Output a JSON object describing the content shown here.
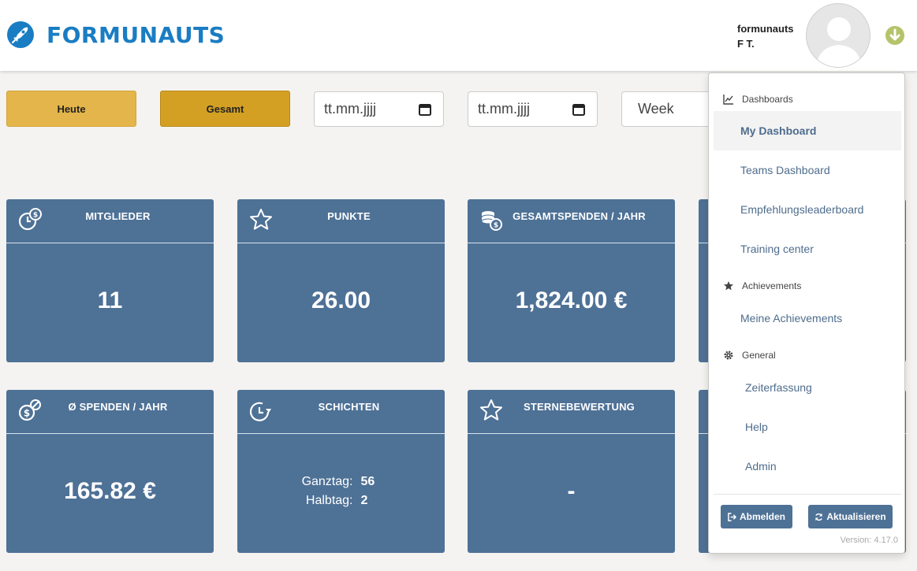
{
  "header": {
    "logo_text": "FORMUNAUTS",
    "user_name": "formunauts",
    "user_initials": "F T."
  },
  "filters": {
    "heute_label": "Heute",
    "gesamt_label": "Gesamt",
    "date_from_placeholder": "tt.mm.jjjj",
    "date_to_placeholder": "tt.mm.jjjj",
    "period_value": "Week"
  },
  "cards": {
    "mitglieder": {
      "title": "MITGLIEDER",
      "value": "11",
      "icon": "clock-dollar-icon"
    },
    "punkte": {
      "title": "PUNKTE",
      "value": "26.00",
      "icon": "star-icon"
    },
    "gesamtspenden": {
      "title": "GESAMTSPENDEN / JAHR",
      "value": "1,824.00 €",
      "icon": "coins-icon"
    },
    "spenden_avg": {
      "title": "Ø SPENDEN / JAHR",
      "value": "165.82 €",
      "icon": "average-dollar-icon"
    },
    "schichten": {
      "title": "SCHICHTEN",
      "icon": "clock-refresh-icon",
      "ganztag_label": "Ganztag:",
      "ganztag_value": "56",
      "halbtag_label": "Halbtag:",
      "halbtag_value": "2"
    },
    "sternebewertung": {
      "title": "STERNEBEWERTUNG",
      "value": "-",
      "icon": "star-icon"
    }
  },
  "menu": {
    "section_dashboards": "Dashboards",
    "my_dashboard": "My Dashboard",
    "teams_dashboard": "Teams Dashboard",
    "empfehlungsleaderboard": "Empfehlungsleaderboard",
    "training_center": "Training center",
    "section_achievements": "Achievements",
    "meine_achievements": "Meine Achievements",
    "section_general": "General",
    "zeiterfassung": "Zeiterfassung",
    "help": "Help",
    "admin": "Admin",
    "abmelden": "Abmelden",
    "aktualisieren": "Aktualisieren",
    "version": "Version: 4.17.0"
  },
  "colors": {
    "brand_blue": "#1a7dc3",
    "card_blue": "#4e7196",
    "gold": "#d4a023",
    "toggle_green": "#b5c36a"
  }
}
